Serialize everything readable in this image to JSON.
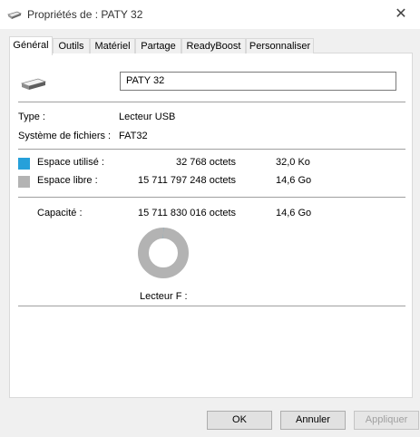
{
  "window": {
    "title": "Propriétés de : PATY 32",
    "close_glyph": "✕"
  },
  "tabs": [
    {
      "label": "Général",
      "active": true
    },
    {
      "label": "Outils",
      "active": false
    },
    {
      "label": "Matériel",
      "active": false
    },
    {
      "label": "Partage",
      "active": false
    },
    {
      "label": "ReadyBoost",
      "active": false
    },
    {
      "label": "Personnaliser",
      "active": false
    }
  ],
  "general": {
    "volume_name": "PATY 32",
    "type_label": "Type :",
    "type_value": "Lecteur USB",
    "fs_label": "Système de fichiers :",
    "fs_value": "FAT32",
    "used_label": "Espace utilisé :",
    "used_bytes": "32 768 octets",
    "used_size": "32,0 Ko",
    "free_label": "Espace libre :",
    "free_bytes": "15 711 797 248 octets",
    "free_size": "14,6 Go",
    "capacity_label": "Capacité :",
    "capacity_bytes": "15 711 830 016 octets",
    "capacity_size": "14,6 Go",
    "drive_label": "Lecteur F :",
    "used_fraction": 2e-06
  },
  "buttons": {
    "ok": "OK",
    "cancel": "Annuler",
    "apply": "Appliquer"
  },
  "colors": {
    "used": "#26a0da",
    "free": "#b3b3b3"
  },
  "icons": {
    "title": "drive-icon",
    "volume": "usb-drive-icon"
  }
}
